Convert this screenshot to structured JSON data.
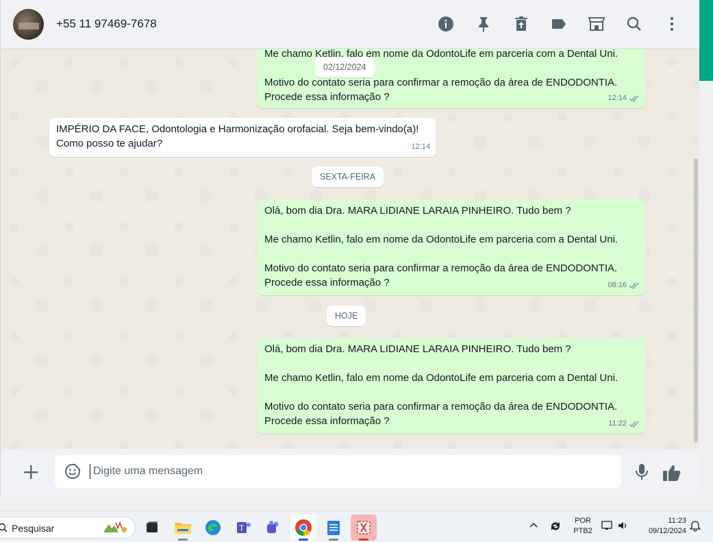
{
  "header": {
    "contact_name": "+55 11 97469-7678",
    "icons": [
      "info-icon",
      "pin-icon",
      "delete-icon",
      "label-icon",
      "store-icon",
      "search-icon",
      "menu-icon"
    ]
  },
  "messages": {
    "m1": {
      "line_a": "Me chamo Ketlin, falo em nome da OdontoLife em parceria com a Dental Uni.",
      "line_b": "Motivo do contato seria para confirmar a remoção da área de ENDODONTIA.",
      "line_c": "Procede essa informação ?",
      "time": "12:14"
    },
    "date_1": "02/12/2024",
    "m2": {
      "line_a": "IMPÉRIO DA  FACE, Odontologia e Harmonização  orofacial. Seja bem-vindo(a)!",
      "line_b": "Como posso te ajudar?",
      "time": "12:14"
    },
    "date_2": "SEXTA-FEIRA",
    "m3": {
      "line_a": "Olá, bom dia Dra. MARA LIDIANE LARAIA PINHEIRO. Tudo bem ?",
      "line_b": "Me chamo Ketlin, falo em nome da OdontoLife em parceria com a Dental Uni.",
      "line_c": "Motivo do contato seria para confirmar a remoção da área de ENDODONTIA.",
      "line_d": "Procede essa informação ?",
      "time": "08:16"
    },
    "date_3": "HOJE",
    "m4": {
      "line_a": "Olá, bom dia Dra. MARA LIDIANE LARAIA PINHEIRO. Tudo bem ?",
      "line_b": "Me chamo Ketlin, falo em nome da OdontoLife em parceria com a Dental Uni.",
      "line_c": "Motivo do contato seria para confirmar a remoção da área de ENDODONTIA.",
      "line_d": "Procede essa informação ?",
      "time": "11:22"
    }
  },
  "composer": {
    "placeholder": "Digite uma mensagem"
  },
  "taskbar": {
    "search_label": "Pesquisar",
    "lang_top": "POR",
    "lang_bottom": "PTB2",
    "time": "11:23",
    "date": "09/12/2024"
  },
  "colors": {
    "outgoing_bubble": "#d9fdd3",
    "incoming_bubble": "#ffffff",
    "chat_background": "#efeae2",
    "accent": "#00a884"
  }
}
